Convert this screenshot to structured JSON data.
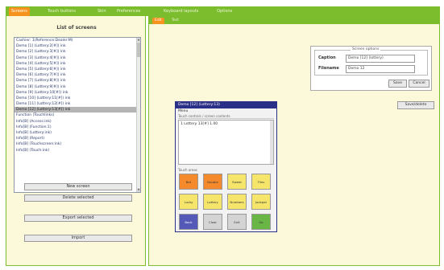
{
  "top_tabs": [
    {
      "label": "Screens",
      "active": true
    },
    {
      "label": "Touch buttons",
      "active": false
    },
    {
      "label": "Skin",
      "active": false
    },
    {
      "label": "Preferences",
      "active": false
    },
    {
      "label": "Keyboard layouts",
      "active": false
    },
    {
      "label": "Options",
      "active": false
    }
  ],
  "left_panel": {
    "title": "List of screens",
    "screens": [
      "Cashier: 1(Reference:Dealer:M)",
      "Demo [1] (Lottery:2[#]) ink",
      "Demo [2] (Lottery:3[#]) ink",
      "Demo [3] (Lottery:4[#]) ink",
      "Demo [4] (Lottery:5[#]) ink",
      "Demo [5] (Lottery:6[#]) ink",
      "Demo [6] (Lottery:7[#]) ink",
      "Demo [7] (Lottery:8[#]) ink",
      "Demo [8] (Lottery:9[#]) ink",
      "Demo [9] (Lottery:10[#]) ink",
      "Demo [10] (Lottery:11[#]) ink",
      "Demo [11] (Lottery:12[#]) ink",
      "Demo [12] (Lottery:13[#]) ink",
      "Function (Touchlinks)",
      "Info[B] (Access:ink)",
      "Info[B] (Function:1)",
      "Info[B] (Lottery:ink)",
      "Info[B] (Report)",
      "Info[B] (Touchscreen:ink)",
      "Info[B] (Touch:ink)"
    ],
    "selected_index": 12,
    "buttons": {
      "new": "New screen",
      "delete": "Delete selected",
      "export": "Export selected",
      "import": "Import"
    }
  },
  "sub_tabs": [
    {
      "label": "Edit",
      "active": true
    },
    {
      "label": "Test",
      "active": false
    }
  ],
  "screen_options": {
    "legend": "Screen options",
    "caption_label": "Caption",
    "caption_value": "Demo [12] (lottery)",
    "filename_label": "Filename",
    "filename_value": "Demo 12",
    "save_label": "Save",
    "cancel_label": "Cancel"
  },
  "save_all_label": "Save/delete",
  "dialog": {
    "title": "Demo [12] (Lottery:13)",
    "menu": "Menu",
    "section": "Touch controls / screen contents",
    "text": "1 Lottery 13[#] 1.00",
    "buttons_label": "Touch areas",
    "keys": [
      {
        "label": "Bet",
        "color": "orange"
      },
      {
        "label": "Double",
        "color": "orange"
      },
      {
        "label": "Sweet",
        "color": "yellow"
      },
      {
        "label": "Tiles",
        "color": "yellow"
      },
      {
        "label": "Lucky",
        "color": "yellow"
      },
      {
        "label": "Lottery",
        "color": "yellow"
      },
      {
        "label": "Numbers",
        "color": "yellow"
      },
      {
        "label": "Jackpot",
        "color": "yellow"
      },
      {
        "label": "Back",
        "color": "blue"
      },
      {
        "label": "Clear",
        "color": "gray"
      },
      {
        "label": "Exit",
        "color": "gray"
      },
      {
        "label": "Go",
        "color": "green"
      }
    ]
  },
  "colors": {
    "green_bar": "#7cbd2e",
    "active_tab": "#f6921e",
    "panel_bg": "#fcf8da",
    "dialog_title": "#2a2f87"
  }
}
